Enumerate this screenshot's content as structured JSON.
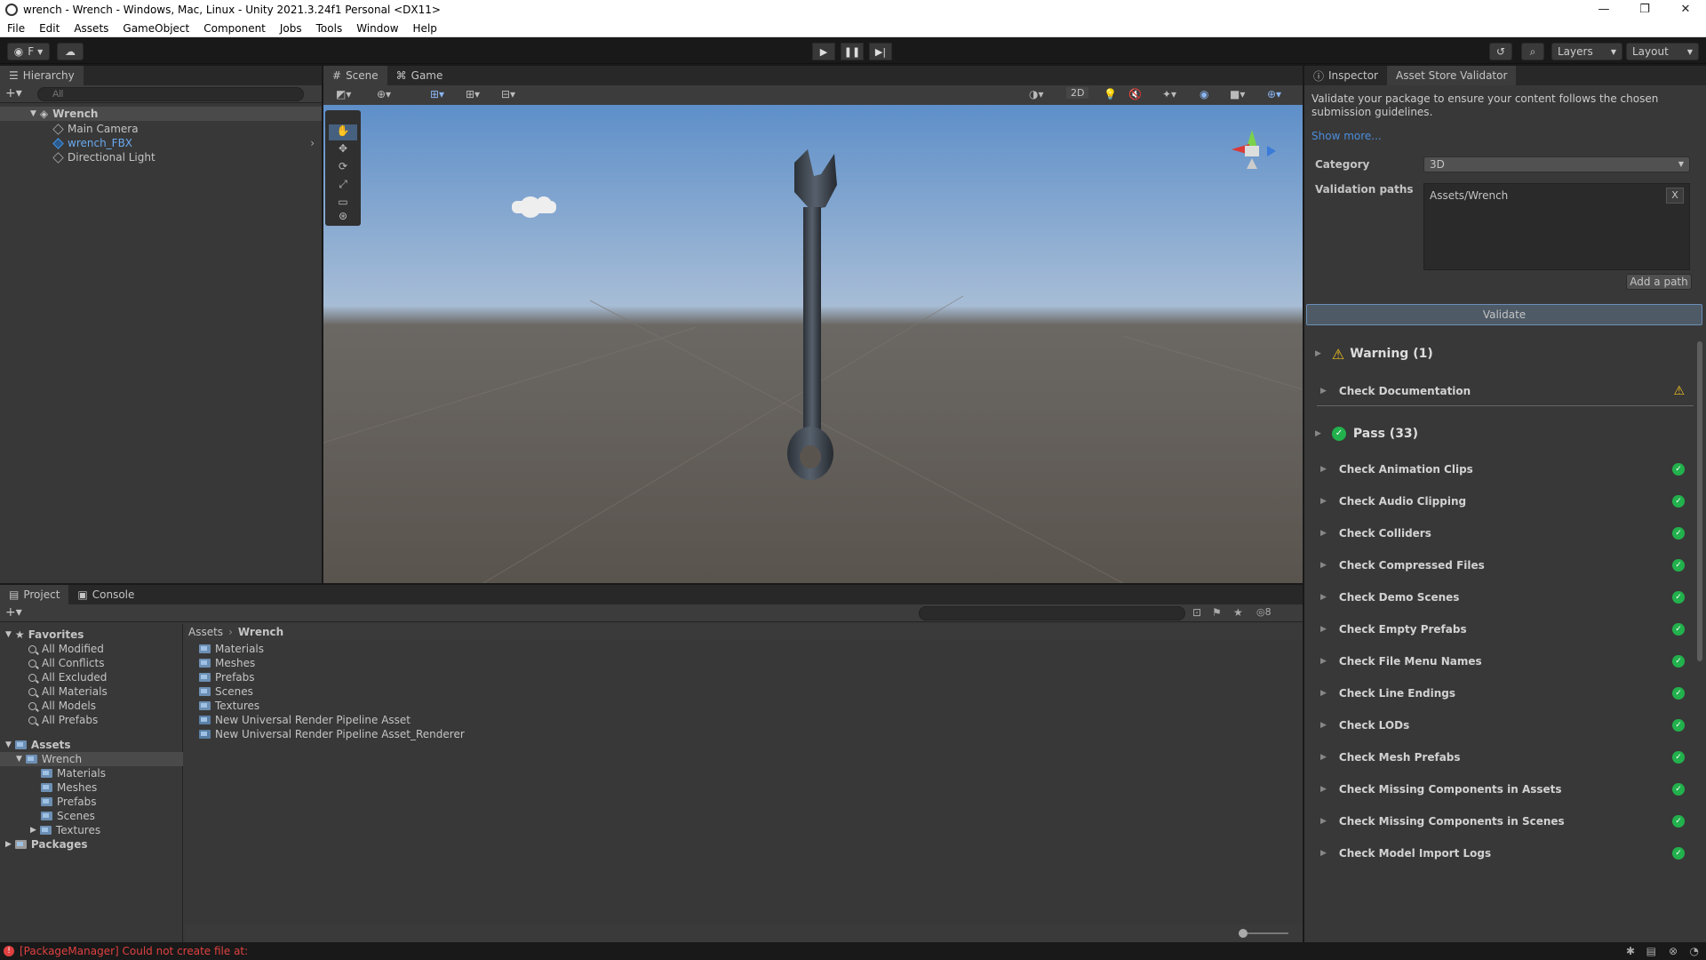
{
  "window": {
    "title": "wrench - Wrench - Windows, Mac, Linux - Unity 2021.3.24f1 Personal <DX11>",
    "controls": [
      "—",
      "❐",
      "✕"
    ]
  },
  "menu": [
    "File",
    "Edit",
    "Assets",
    "GameObject",
    "Component",
    "Jobs",
    "Tools",
    "Window",
    "Help"
  ],
  "toolbar": {
    "account": "F",
    "layers": "Layers",
    "layout": "Layout"
  },
  "hierarchy": {
    "tab": "Hierarchy",
    "search_placeholder": "All",
    "root": "Wrench",
    "items": [
      "Main Camera",
      "wrench_FBX",
      "Directional Light"
    ]
  },
  "scene": {
    "tabs": [
      "Scene",
      "Game"
    ],
    "mode_2d": "2D"
  },
  "project": {
    "tabs": [
      "Project",
      "Console"
    ],
    "favorites_label": "Favorites",
    "favorites": [
      "All Modified",
      "All Conflicts",
      "All Excluded",
      "All Materials",
      "All Models",
      "All Prefabs"
    ],
    "assets_label": "Assets",
    "tree_root": "Wrench",
    "tree_children": [
      "Materials",
      "Meshes",
      "Prefabs",
      "Scenes",
      "Textures"
    ],
    "packages_label": "Packages",
    "breadcrumb": [
      "Assets",
      "Wrench"
    ],
    "files": [
      "Materials",
      "Meshes",
      "Prefabs",
      "Scenes",
      "Textures",
      "New Universal Render Pipeline Asset",
      "New Universal Render Pipeline Asset_Renderer"
    ],
    "hidden_count": "8"
  },
  "inspector": {
    "tabs": [
      "Inspector",
      "Asset Store Validator"
    ],
    "description": "Validate your package to ensure your content follows the chosen submission guidelines.",
    "show_more": "Show more...",
    "category_label": "Category",
    "category_value": "3D",
    "paths_label": "Validation paths",
    "path_value": "Assets/Wrench",
    "remove_label": "X",
    "add_path": "Add a path",
    "validate": "Validate",
    "warning_header": "Warning (1)",
    "warning_items": [
      "Check Documentation"
    ],
    "pass_header": "Pass (33)",
    "pass_items": [
      "Check Animation Clips",
      "Check Audio Clipping",
      "Check Colliders",
      "Check Compressed Files",
      "Check Demo Scenes",
      "Check Empty Prefabs",
      "Check File Menu Names",
      "Check Line Endings",
      "Check LODs",
      "Check Mesh Prefabs",
      "Check Missing Components in Assets",
      "Check Missing Components in Scenes",
      "Check Model Import Logs"
    ]
  },
  "status": {
    "message": "[PackageManager] Could not create file at:"
  }
}
